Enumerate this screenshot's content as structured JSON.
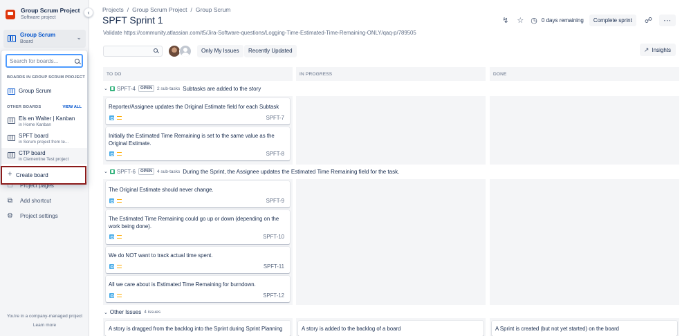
{
  "sidebar": {
    "project_name": "Group Scrum Project",
    "project_type": "Software project",
    "board_selector": {
      "title": "Group Scrum",
      "subtitle": "Board"
    },
    "dropdown": {
      "search_placeholder": "Search for boards...",
      "section_project": "BOARDS IN GROUP SCRUM PROJECT",
      "section_other": "OTHER BOARDS",
      "view_all": "VIEW ALL",
      "project_boards": [
        {
          "name": "Group Scrum"
        }
      ],
      "other_boards": [
        {
          "name": "Els en Walter | Kanban",
          "location": "in Home Kanban"
        },
        {
          "name": "SPFT board",
          "location": "in Scrum project from te..."
        },
        {
          "name": "CTP board",
          "location": "in Clementine Test project"
        }
      ],
      "create_board": "Create board"
    },
    "links": [
      {
        "label": "Project pages",
        "icon": "page-icon"
      },
      {
        "label": "Add shortcut",
        "icon": "add-shortcut-icon"
      },
      {
        "label": "Project settings",
        "icon": "gear-icon"
      }
    ],
    "footer_text": "You're in a company-managed project",
    "learn_more": "Learn more"
  },
  "header": {
    "breadcrumb": [
      "Projects",
      "Group Scrum Project",
      "Group Scrum"
    ],
    "title": "SPFT Sprint 1",
    "validate_text": "Validate https://community.atlassian.com/t5/Jira-Software-questions/Logging-Time-Estimated-Time-Remaining-ONLY/qaq-p/789505",
    "days_remaining": "0 days remaining",
    "complete_sprint": "Complete sprint"
  },
  "toolbar": {
    "only_my_issues": "Only My Issues",
    "recently_updated": "Recently Updated",
    "insights": "Insights"
  },
  "columns": [
    "TO DO",
    "IN PROGRESS",
    "DONE"
  ],
  "swimlanes": [
    {
      "key": "SPFT-4",
      "status": "OPEN",
      "subtasks": "2 sub-tasks",
      "summary": "Subtasks are added to the story",
      "cards": [
        {
          "text": "Reporter/Assignee updates the Original Estimate field for each Subtask",
          "key": "SPFT-7"
        },
        {
          "text": "Initially the Estimated Time Remaining is set to the same value as the Original Estimate.",
          "key": "SPFT-8"
        }
      ]
    },
    {
      "key": "SPFT-6",
      "status": "OPEN",
      "subtasks": "4 sub-tasks",
      "summary": "During the Sprint, the Assignee updates the Estimated Time Remaining field for the task.",
      "cards": [
        {
          "text": "The Original Estimate should never change.",
          "key": "SPFT-9"
        },
        {
          "text": "The Estimated Time Remaining could go up or down (depending on the work being done).",
          "key": "SPFT-10"
        },
        {
          "text": "We do NOT want to track actual time spent.",
          "key": "SPFT-11"
        },
        {
          "text": "All we care about is Estimated Time Remaining for burndown.",
          "key": "SPFT-12"
        }
      ]
    }
  ],
  "other_issues": {
    "label": "Other Issues",
    "count": "4 issues",
    "cards": [
      "A story is dragged from the backlog into the Sprint during Sprint Planning",
      "A story is added to the backlog of a board",
      "A Sprint is created (but not yet started) on the board"
    ]
  },
  "colors": {
    "accent": "#0052cc",
    "highlight_border": "#8b1a1a",
    "lane_bg": "#f4f5f7"
  }
}
